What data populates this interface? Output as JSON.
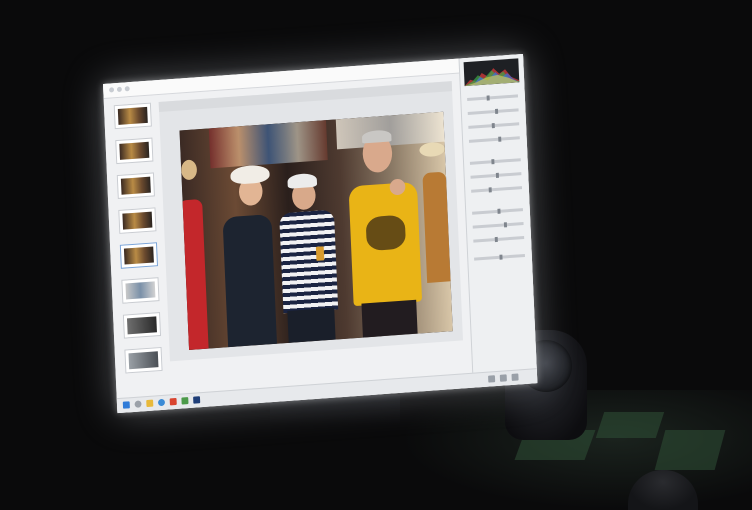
{
  "scene": {
    "description_tags": [
      "monitor",
      "photo-editor",
      "desk-speaker",
      "sticky-notes",
      "mouse"
    ],
    "colors": {
      "background": "#0a0a0b",
      "screen_glow": "#f4f5f6",
      "accent_blue": "#2f7bd8",
      "shirt_yellow": "#e9b416",
      "dress_red": "#c3272b"
    }
  },
  "editor": {
    "status_caption": "",
    "taskbar_icons": [
      "windows-icon",
      "search-icon",
      "folder-icon",
      "browser-icon",
      "app-icon",
      "app-icon",
      "photo-app-icon"
    ]
  }
}
